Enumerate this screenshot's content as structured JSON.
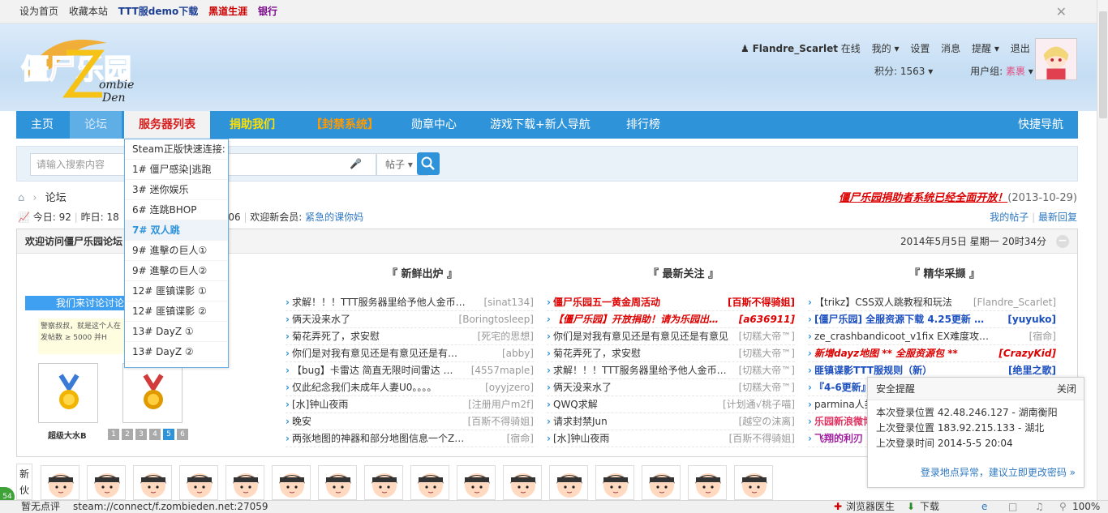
{
  "topbar": {
    "links": [
      "设为首页",
      "收藏本站",
      "TTT服demo下载",
      "黑道生涯",
      "银行"
    ],
    "close": "✕"
  },
  "user": {
    "name": "Flandre_Scarlet",
    "status": "在线",
    "menu": [
      "我的",
      "设置",
      "消息",
      "提醒",
      "退出"
    ],
    "points_label": "积分:",
    "points": "1563",
    "group_label": "用户组:",
    "group": "素裹"
  },
  "nav": {
    "items": [
      "主页",
      "论坛",
      "服务器列表",
      "捐助我们",
      "【封禁系统】",
      "勋章中心",
      "游戏下载+新人导航",
      "排行榜"
    ],
    "quick": "快捷导航"
  },
  "search": {
    "placeholder": "请输入搜索内容",
    "type": "帖子"
  },
  "crumb": {
    "home": "论坛"
  },
  "announce": {
    "text": "僵尸乐园捐助者系统已经全面开放！",
    "date": "(2013-10-29)"
  },
  "stats": {
    "today_label": "今日: 92",
    "yesterday_label": "昨日: 18",
    "members": ": 36606",
    "welcome": "欢迎新会员:",
    "newest": "紧急的课你妈"
  },
  "mylinks": [
    "我的帖子",
    "最新回复"
  ],
  "panel": {
    "title": "欢迎访问僵尸乐园论坛",
    "date": "2014年5月5日 星期一 20时34分",
    "minimize": "−",
    "col_titles": [
      "『 新鲜出炉 』",
      "『 最新关注 』",
      "『 精华采撷 』"
    ]
  },
  "left": {
    "title": "我们来讨论讨论",
    "note": "警察叔叔，就是这个人在发帖数 ≥ 5000  并H",
    "medal_label": "超级大水B",
    "pages": [
      "1",
      "2",
      "3",
      "4",
      "5",
      "6"
    ]
  },
  "col1": [
    {
      "t": "求解！！！TTT服务器里给予他人金币的格式",
      "a": "[sinat134]"
    },
    {
      "t": "俩天没来水了",
      "a": "[Boringtosleep]"
    },
    {
      "t": "菊花弄死了，求安慰",
      "a": "[死宅的思想]"
    },
    {
      "t": "你们是对我有意见还是有意见还是有意见？！",
      "a": "[abby]"
    },
    {
      "t": "【bug】卡雷达 简直无限时间雷达 …",
      "a": "[4557maple]"
    },
    {
      "t": "仅此纪念我们未成年人妻U0。。。。",
      "a": "[oyyjzero]"
    },
    {
      "t": "[水]钟山夜雨",
      "a": "[注册用户m2f]"
    },
    {
      "t": "晚安",
      "a": "[百斯不得骑姐]"
    },
    {
      "t": "两张地图的神器和部分地图信息一个ZM密码 …",
      "a": "[宿命]"
    }
  ],
  "col2": [
    {
      "t": "僵尸乐园五一黄金周活动",
      "a": "[百斯不得骑姐]",
      "s": "red"
    },
    {
      "t": "【僵尸乐园】开放捐助！请为乐园出一分力",
      "a": "[a636911]",
      "s": "red-i"
    },
    {
      "t": "你们是对我有意见还是有意见还是有意见",
      "a": "[切糕大帝™]"
    },
    {
      "t": "菊花弄死了，求安慰",
      "a": "[切糕大帝™]"
    },
    {
      "t": "求解！！！TTT服务器里给予他人金币的格",
      "a": "[切糕大帝™]"
    },
    {
      "t": "俩天没来水了",
      "a": "[切糕大帝™]"
    },
    {
      "t": "QWQ求解",
      "a": "[计划通√桃子喵]"
    },
    {
      "t": "请求封禁Jun",
      "a": "[越空の沫离]"
    },
    {
      "t": "[水]钟山夜雨",
      "a": "[百斯不得骑姐]"
    }
  ],
  "col3": [
    {
      "t": "【trikz】CSS双人跳教程和玩法",
      "a": "[Flandre_Scarlet]"
    },
    {
      "t": "[僵尸乐园] 全服资源下载 4.25更新 …",
      "a": "[yuyuko]",
      "s": "blue-b"
    },
    {
      "t": "ze_crashbandicoot_v1fix EX难度攻略视频除",
      "a": "[宿命]"
    },
    {
      "t": "新增dayz地图 ** 全服资源包 **",
      "a": "[CrazyKid]",
      "s": "red-i"
    },
    {
      "t": "匪镇谍影TTT服规则（新）",
      "a": "[绝里之歌]",
      "s": "blue-b"
    },
    {
      "t": "『4-6更新』",
      "a": "",
      "s": "blue-b"
    },
    {
      "t": "parmina人类",
      "a": ""
    },
    {
      "t": "乐园新浪微博",
      "a": "",
      "s": "pink-b"
    },
    {
      "t": "飞翔的利刃",
      "a": "",
      "s": "purple-b"
    }
  ],
  "dropdown": {
    "header": "Steam正版快速连接:",
    "items": [
      "1# 僵尸感染|逃跑",
      "3# 迷你娱乐",
      "6# 连跳BHOP",
      "7# 双人跳",
      "9# 進擊の巨人①",
      "9# 進擊の巨人②",
      "12# 匪镇谍影 ①",
      "12# 匪镇谍影 ②",
      "13# DayZ ①",
      "13# DayZ ②"
    ],
    "selected": 3
  },
  "security": {
    "title": "安全提醒",
    "close": "关闭",
    "lines": [
      "本次登录位置 42.48.246.127 - 湖南衡阳",
      "上次登录位置 183.92.215.133 - 湖北",
      "上次登录时间 2014-5-5 20:04"
    ],
    "footer": "登录地点异常，建议立即更改密码 »"
  },
  "friends": {
    "label": "新伙"
  },
  "statusbar": {
    "left1": "暂无点评",
    "url": "steam://connect/f.zombieden.net:27059",
    "doctor": "浏览器医生",
    "download": "下载",
    "zoom": "100%",
    "badge": "54"
  },
  "colors": {
    "nav": "#2e93d9",
    "accent_red": "#d00000",
    "link_blue": "#2e78c2"
  }
}
